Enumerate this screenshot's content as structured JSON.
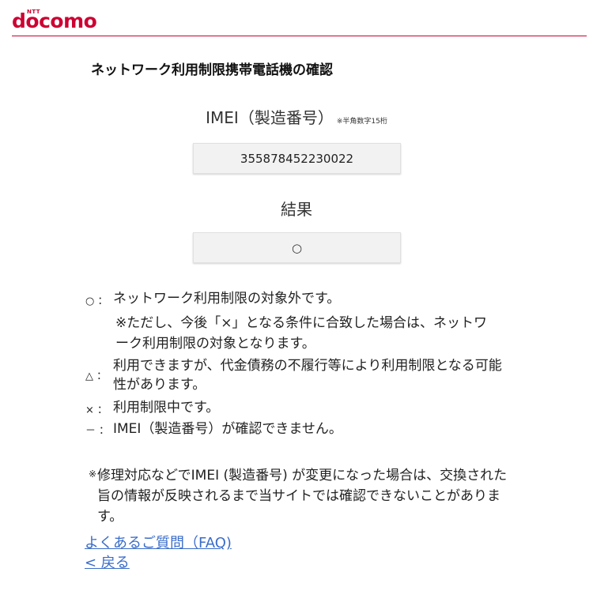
{
  "header": {
    "logo_small": "NTT",
    "logo_main": "docomo",
    "accent_color": "#cc0033"
  },
  "page_title": "ネットワーク利用制限携帯電話機の確認",
  "imei": {
    "label": "IMEI（製造番号）",
    "note": "※半角数字15桁",
    "value": "355878452230022"
  },
  "result": {
    "label": "結果",
    "symbol": "○"
  },
  "legend": [
    {
      "symbol": "○ ：",
      "text": "ネットワーク利用制限の対象外です。",
      "sub": "※ただし、今後「×」となる条件に合致した場合は、ネットワーク利用制限の対象となります。"
    },
    {
      "symbol": "△ ：",
      "text": "利用できますが、代金債務の不履行等により利用制限となる可能性があります。"
    },
    {
      "symbol": "× ：",
      "text": "利用制限中です。"
    },
    {
      "symbol": "－ ：",
      "text": "IMEI（製造番号）が確認できません。"
    }
  ],
  "footnote": {
    "mark": "※",
    "text": "修理対応などでIMEI (製造番号) が変更になった場合は、交換された旨の情報が反映されるまで当サイトでは確認できないことがあります。"
  },
  "links": {
    "faq": "よくあるご質問（FAQ)",
    "back": "< 戻る",
    "link_color": "#3a6cc9"
  }
}
